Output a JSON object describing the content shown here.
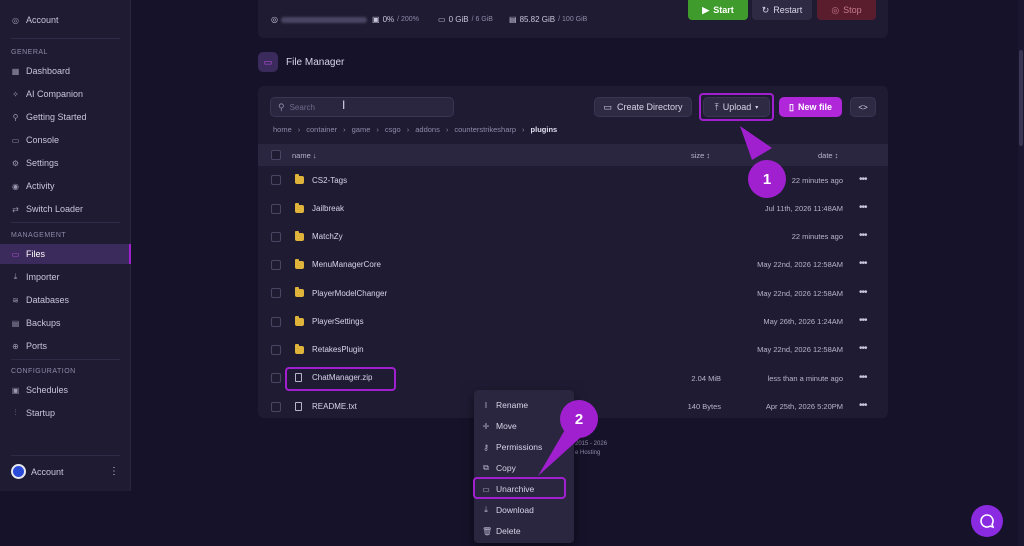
{
  "sidebar": {
    "top_item": "Account",
    "sections": {
      "general": "GENERAL",
      "management": "MANAGEMENT",
      "configuration": "CONFIGURATION"
    },
    "general_items": [
      {
        "label": "Dashboard",
        "icon": "grid-icon"
      },
      {
        "label": "AI Companion",
        "icon": "sparkle-icon"
      },
      {
        "label": "Getting Started",
        "icon": "search-icon"
      },
      {
        "label": "Console",
        "icon": "terminal-icon"
      },
      {
        "label": "Settings",
        "icon": "gear-icon"
      },
      {
        "label": "Activity",
        "icon": "eye-icon"
      },
      {
        "label": "Switch Loader",
        "icon": "switch-icon"
      }
    ],
    "management_items": [
      {
        "label": "Files",
        "icon": "folder-icon",
        "active": true
      },
      {
        "label": "Importer",
        "icon": "download-icon"
      },
      {
        "label": "Databases",
        "icon": "database-icon"
      },
      {
        "label": "Backups",
        "icon": "archive-icon"
      },
      {
        "label": "Ports",
        "icon": "globe-icon"
      }
    ],
    "configuration_items": [
      {
        "label": "Schedules",
        "icon": "calendar-icon"
      },
      {
        "label": "Startup",
        "icon": "sliders-icon"
      }
    ],
    "account_label": "Account"
  },
  "server": {
    "cpu": "0%",
    "cpu_limit": "/ 200%",
    "memory": "0 GiB",
    "memory_limit": "/ 6 GiB",
    "disk": "85.82 GiB",
    "disk_limit": "/ 100 GiB",
    "start_label": "Start",
    "restart_label": "Restart",
    "stop_label": "Stop"
  },
  "file_manager": {
    "title": "File Manager",
    "search_placeholder": "Search",
    "create_directory_label": "Create Directory",
    "upload_label": "Upload",
    "new_file_label": "New file",
    "code_label": "<>",
    "breadcrumb": [
      "home",
      "container",
      "game",
      "csgo",
      "addons",
      "counterstrikesharp",
      "plugins"
    ],
    "columns": {
      "name": "name ↓",
      "size": "size ↕",
      "date": "date ↕"
    },
    "rows": [
      {
        "name": "CS2-Tags",
        "type": "folder",
        "size": "",
        "date": "22 minutes ago"
      },
      {
        "name": "Jailbreak",
        "type": "folder",
        "size": "",
        "date": "Jul 11th, 2026 11:48AM"
      },
      {
        "name": "MatchZy",
        "type": "folder",
        "size": "",
        "date": "22 minutes ago"
      },
      {
        "name": "MenuManagerCore",
        "type": "folder",
        "size": "",
        "date": "May 22nd, 2026 12:58AM"
      },
      {
        "name": "PlayerModelChanger",
        "type": "folder",
        "size": "",
        "date": "May 22nd, 2026 12:58AM"
      },
      {
        "name": "PlayerSettings",
        "type": "folder",
        "size": "",
        "date": "May 26th, 2026 1:24AM"
      },
      {
        "name": "RetakesPlugin",
        "type": "folder",
        "size": "",
        "date": "May 22nd, 2026 12:58AM"
      },
      {
        "name": "ChatManager.zip",
        "type": "file",
        "size": "2.04 MiB",
        "date": "less than a minute ago"
      },
      {
        "name": "README.txt",
        "type": "file",
        "size": "140 Bytes",
        "date": "Apr 25th, 2026 5:20PM"
      }
    ]
  },
  "context_menu": [
    {
      "label": "Rename",
      "icon": "cursor-icon"
    },
    {
      "label": "Move",
      "icon": "move-icon"
    },
    {
      "label": "Permissions",
      "icon": "key-icon"
    },
    {
      "label": "Copy",
      "icon": "copy-icon"
    },
    {
      "label": "Unarchive",
      "icon": "unarchive-icon",
      "highlighted": true
    },
    {
      "label": "Download",
      "icon": "download-icon"
    },
    {
      "label": "Delete",
      "icon": "trash-icon"
    }
  ],
  "footer": {
    "line1": "2015 - 2026",
    "line2": "e Hosting"
  },
  "callouts": [
    "1",
    "2"
  ],
  "colors": {
    "accent": "#a020d0",
    "start": "#3f9b2b",
    "folder": "#e0b33a"
  }
}
